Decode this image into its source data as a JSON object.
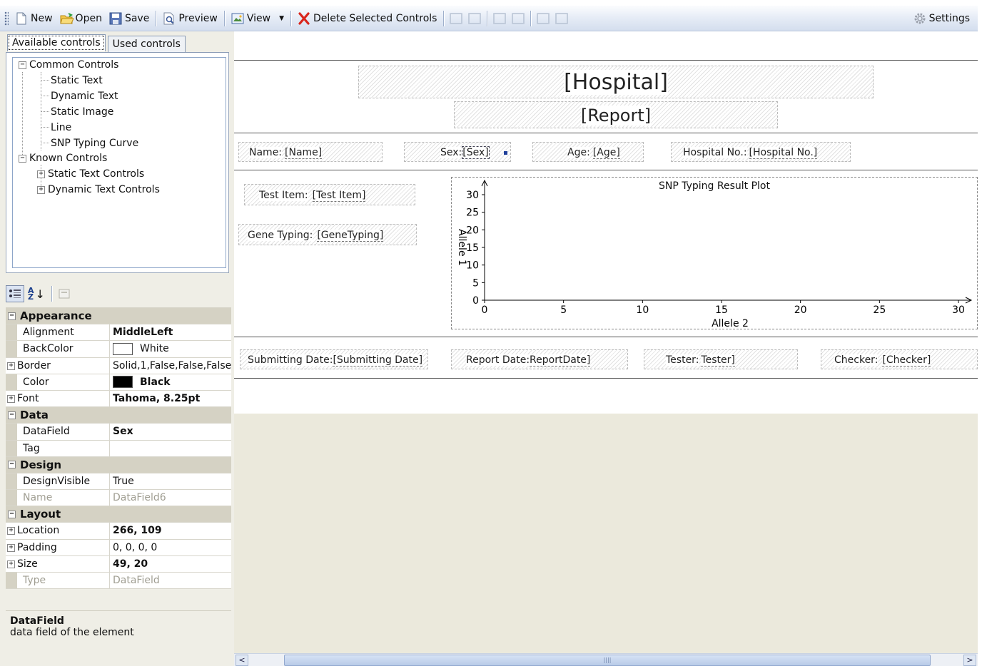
{
  "toolbar": {
    "new_label": "New",
    "open_label": "Open",
    "save_label": "Save",
    "preview_label": "Preview",
    "view_label": "View",
    "delete_label": "Delete Selected Controls",
    "settings_label": "Settings"
  },
  "tabs": {
    "available": "Available controls",
    "used": "Used controls"
  },
  "tree": {
    "common": "Common Controls",
    "static_text": "Static Text",
    "dynamic_text": "Dynamic Text",
    "static_image": "Static Image",
    "line": "Line",
    "snp_curve": "SNP Typing Curve",
    "known": "Known Controls",
    "static_text_controls": "Static Text Controls",
    "dynamic_text_controls": "Dynamic Text Controls"
  },
  "props": {
    "appearance": "Appearance",
    "alignment_name": "Alignment",
    "alignment_val": "MiddleLeft",
    "backcolor_name": "BackColor",
    "backcolor_val": "White",
    "backcolor_hex": "#ffffff",
    "border_name": "Border",
    "border_val": "Solid,1,False,False,False",
    "color_name": "Color",
    "color_val": "Black",
    "color_hex": "#000000",
    "font_name": "Font",
    "font_val": "Tahoma, 8.25pt",
    "data": "Data",
    "datafield_name": "DataField",
    "datafield_val": "Sex",
    "tag_name": "Tag",
    "tag_val": "",
    "design": "Design",
    "designvisible_name": "DesignVisible",
    "designvisible_val": "True",
    "name_name": "Name",
    "name_val": "DataField6",
    "layout": "Layout",
    "location_name": "Location",
    "location_val": "266, 109",
    "padding_name": "Padding",
    "padding_val": "0, 0, 0, 0",
    "size_name": "Size",
    "size_val": "49, 20",
    "type_name": "Type",
    "type_val": "DataField"
  },
  "description": {
    "title": "DataField",
    "text": "data field of the element"
  },
  "report": {
    "hospital": "[Hospital]",
    "report": "[Report]",
    "name_label": "Name:",
    "name_val": "[Name]",
    "sex_label": "Sex:",
    "sex_val": "[Sex]",
    "age_label": "Age:",
    "age_val": "[Age]",
    "hospno_label": "Hospital No.:",
    "hospno_val": "[Hospital No.]",
    "testitem_label": "Test Item:",
    "testitem_val": "[Test Item]",
    "genetyping_label": "Gene Typing:",
    "genetyping_val": "[GeneTyping]",
    "subdate_label": "Submitting Date:",
    "subdate_val": "[Submitting Date]",
    "repdate_label": "Report Date:",
    "repdate_val": "ReportDate]",
    "tester_label": "Tester:",
    "tester_val": "Tester]",
    "checker_label": "Checker:",
    "checker_val": "[Checker]"
  },
  "chart_data": {
    "type": "line",
    "title": "SNP Typing Result Plot",
    "xlabel": "Allele 2",
    "ylabel": "Allele 1",
    "xlim": [
      0,
      30
    ],
    "ylim": [
      0,
      30
    ],
    "x_ticks": [
      0,
      5,
      10,
      15,
      20,
      25,
      30
    ],
    "y_ticks": [
      0,
      5,
      10,
      15,
      20,
      25,
      30
    ],
    "series": [],
    "grid": false
  }
}
